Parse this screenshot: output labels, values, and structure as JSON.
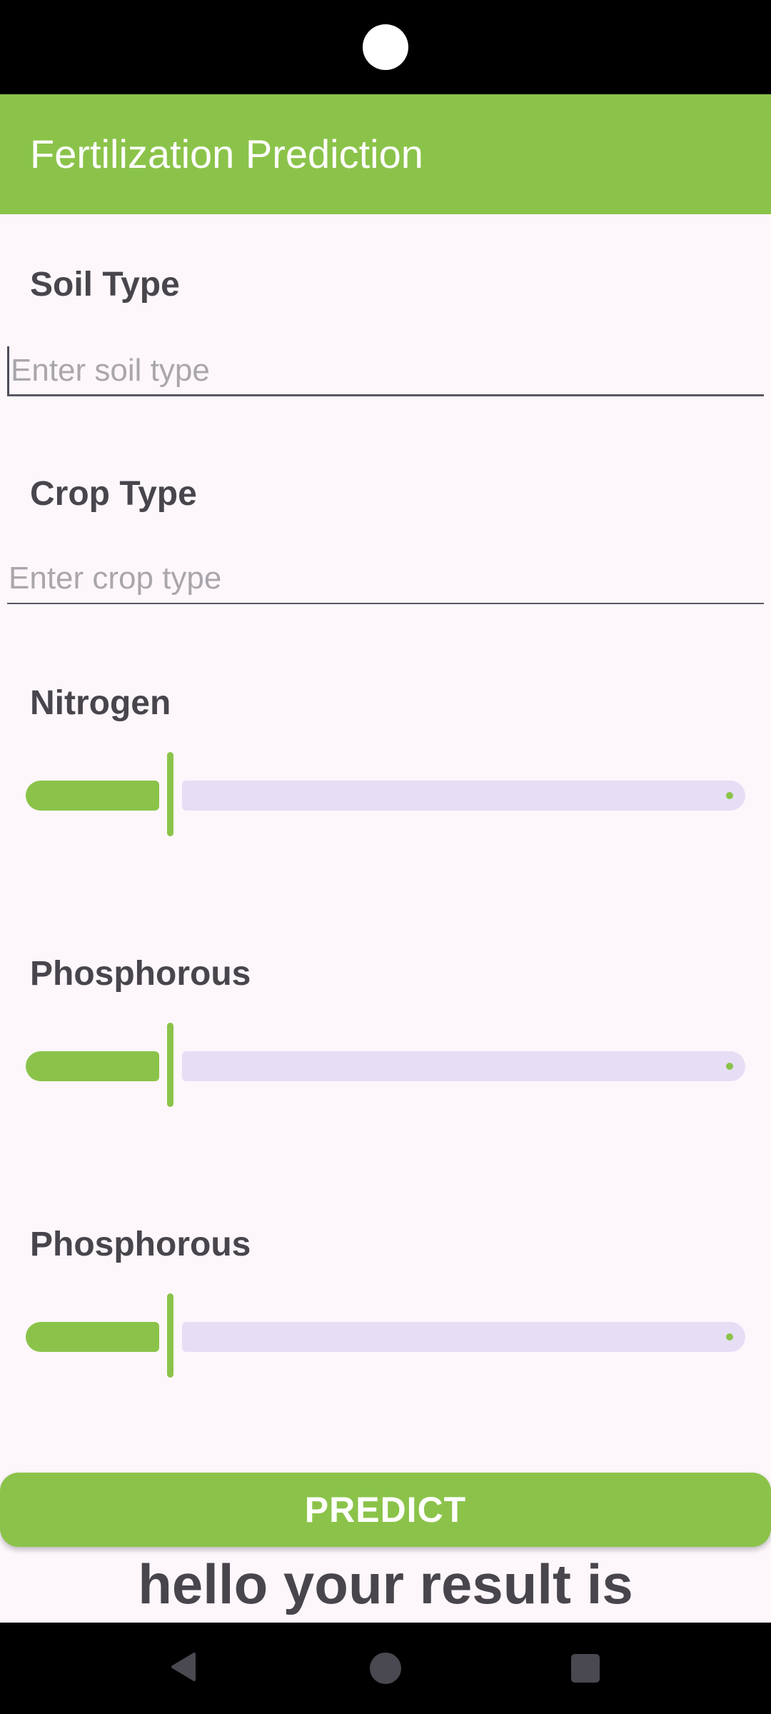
{
  "app": {
    "title": "Fertilization Prediction"
  },
  "form": {
    "soil_label": "Soil Type",
    "soil_placeholder": "Enter soil type",
    "soil_value": "",
    "crop_label": "Crop Type",
    "crop_placeholder": "Enter crop type",
    "crop_value": "",
    "sliders": [
      {
        "label": "Nitrogen",
        "fraction": 0.2
      },
      {
        "label": "Phosphorous",
        "fraction": 0.2
      },
      {
        "label": "Phosphorous",
        "fraction": 0.2
      }
    ],
    "predict_label": "PREDICT",
    "result_text": "hello your result is"
  },
  "colors": {
    "accent": "#8bc34a",
    "background": "#fdf7fc",
    "track_inactive": "#e6def5",
    "text": "#48464c"
  },
  "icons": {
    "nav_back": "back-triangle-icon",
    "nav_home": "home-circle-icon",
    "nav_recents": "recents-square-icon",
    "camera": "front-camera-icon"
  }
}
